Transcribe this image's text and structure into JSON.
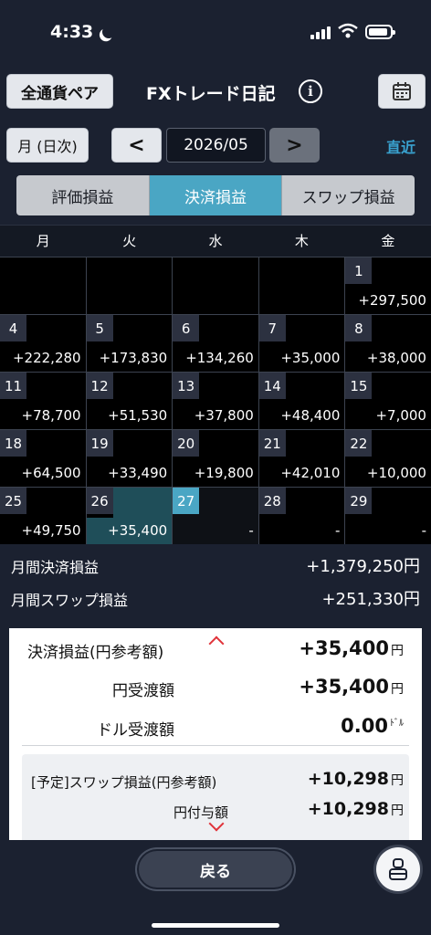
{
  "status": {
    "time": "4:33"
  },
  "header": {
    "pair_button": "全通貨ペア",
    "title": "FXトレード日記",
    "info": "i"
  },
  "nav": {
    "mode": "月 (日次)",
    "prev": "<",
    "date": "2026/05",
    "next": ">",
    "recent": "直近"
  },
  "tabs": [
    "評価損益",
    "決済損益",
    "スワップ損益"
  ],
  "weekdays": [
    "月",
    "火",
    "水",
    "木",
    "金"
  ],
  "cells": [
    {
      "day": "",
      "amount": ""
    },
    {
      "day": "",
      "amount": ""
    },
    {
      "day": "",
      "amount": ""
    },
    {
      "day": "",
      "amount": ""
    },
    {
      "day": "1",
      "amount": "+297,500"
    },
    {
      "day": "4",
      "amount": "+222,280"
    },
    {
      "day": "5",
      "amount": "+173,830"
    },
    {
      "day": "6",
      "amount": "+134,260"
    },
    {
      "day": "7",
      "amount": "+35,000"
    },
    {
      "day": "8",
      "amount": "+38,000"
    },
    {
      "day": "11",
      "amount": "+78,700"
    },
    {
      "day": "12",
      "amount": "+51,530"
    },
    {
      "day": "13",
      "amount": "+37,800"
    },
    {
      "day": "14",
      "amount": "+48,400"
    },
    {
      "day": "15",
      "amount": "+7,000"
    },
    {
      "day": "18",
      "amount": "+64,500"
    },
    {
      "day": "19",
      "amount": "+33,490"
    },
    {
      "day": "20",
      "amount": "+19,800"
    },
    {
      "day": "21",
      "amount": "+42,010"
    },
    {
      "day": "22",
      "amount": "+10,000"
    },
    {
      "day": "25",
      "amount": "+49,750"
    },
    {
      "day": "26",
      "amount": "+35,400"
    },
    {
      "day": "27",
      "amount": "-"
    },
    {
      "day": "28",
      "amount": "-"
    },
    {
      "day": "29",
      "amount": "-"
    }
  ],
  "summary": {
    "settled_label": "月間決済損益",
    "settled_value": "+1,379,250円",
    "swap_label": "月間スワップ損益",
    "swap_value": "+251,330円"
  },
  "detail": {
    "settled_label": "決済損益(円参考額)",
    "settled_value": "+35,400",
    "yen_label": "円受渡額",
    "yen_value": "+35,400",
    "usd_label": "ドル受渡額",
    "usd_value": "0.00",
    "unit_yen": "円",
    "unit_usd": "ﾄﾞﾙ",
    "swap_label": "[予定]スワップ損益(円参考額)",
    "swap_value": "+10,298",
    "grant_label": "円付与額",
    "grant_value": "+10,298"
  },
  "bottom": {
    "back": "戻る",
    "menu_icon": "menu-icon"
  }
}
